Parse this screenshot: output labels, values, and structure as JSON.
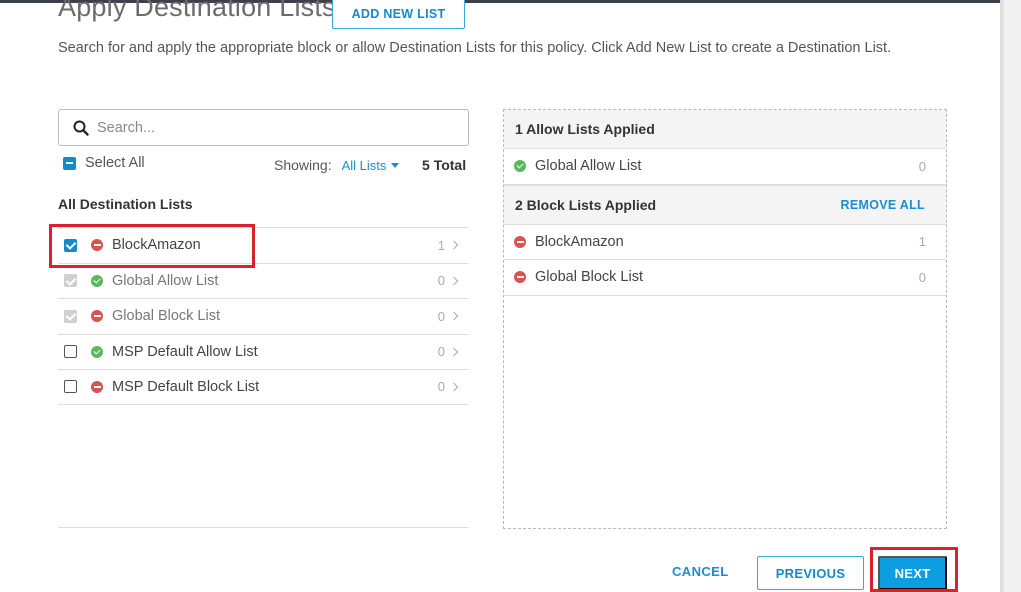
{
  "header": {
    "title": "Apply Destination Lists",
    "add_new_label": "ADD NEW LIST",
    "description": "Search for and apply the appropriate block or allow Destination Lists for this policy. Click Add New List to create a Destination List."
  },
  "search": {
    "placeholder": "Search..."
  },
  "controls": {
    "select_all_label": "Select All",
    "showing_label": "Showing:",
    "filter_value": "All Lists",
    "total": "5 Total"
  },
  "all_lists": {
    "title": "All Destination Lists",
    "items": [
      {
        "name": "BlockAmazon",
        "type": "block",
        "count": "1",
        "state": "checked"
      },
      {
        "name": "Global Allow List",
        "type": "allow",
        "count": "0",
        "state": "disabled"
      },
      {
        "name": "Global Block List",
        "type": "block",
        "count": "0",
        "state": "disabled"
      },
      {
        "name": "MSP Default Allow List",
        "type": "allow",
        "count": "0",
        "state": "unchecked"
      },
      {
        "name": "MSP Default Block List",
        "type": "block",
        "count": "0",
        "state": "unchecked"
      }
    ]
  },
  "applied": {
    "allow_header": "1 Allow Lists Applied",
    "allow_items": [
      {
        "name": "Global Allow List",
        "type": "allow",
        "count": "0"
      }
    ],
    "block_header": "2 Block Lists Applied",
    "remove_all_label": "REMOVE ALL",
    "block_items": [
      {
        "name": "BlockAmazon",
        "type": "block",
        "count": "1"
      },
      {
        "name": "Global Block List",
        "type": "block",
        "count": "0"
      }
    ]
  },
  "footer": {
    "cancel_label": "CANCEL",
    "previous_label": "PREVIOUS",
    "next_label": "NEXT"
  },
  "colors": {
    "accent": "#1b8ed0",
    "primary_button": "#0c9ee0",
    "block_status": "#d9534f",
    "allow_status": "#5cb85c",
    "highlight": "#d9232c"
  }
}
